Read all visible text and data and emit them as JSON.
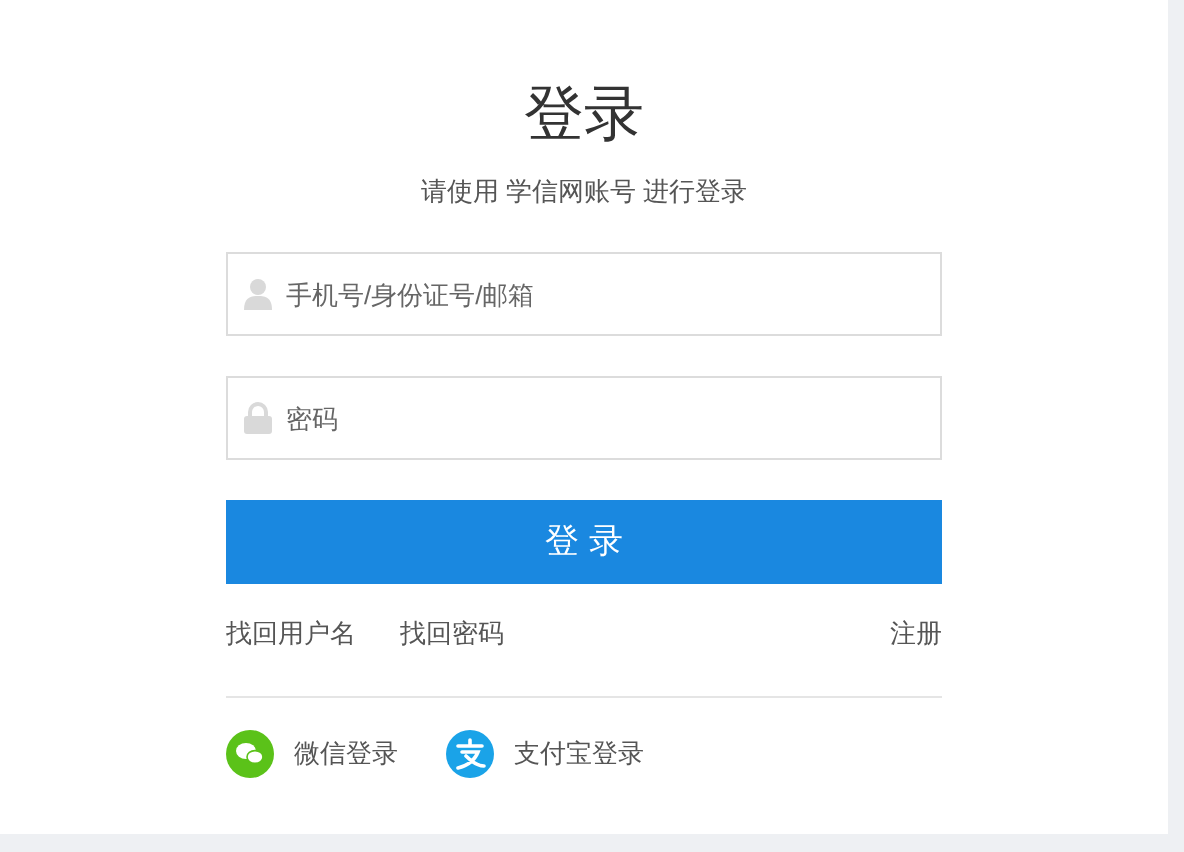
{
  "title": "登录",
  "subtitle": "请使用 学信网账号 进行登录",
  "fields": [
    {
      "kind": "user",
      "placeholder": "手机号/身份证号/邮箱"
    },
    {
      "kind": "password",
      "placeholder": "密码"
    }
  ],
  "login_button": "登 录",
  "links": [
    {
      "label": "找回用户名"
    },
    {
      "label": "找回密码"
    }
  ],
  "register_link": "注册",
  "social_logins": [
    {
      "kind": "wechat",
      "label": "微信登录"
    },
    {
      "kind": "alipay",
      "label": "支付宝登录"
    }
  ]
}
